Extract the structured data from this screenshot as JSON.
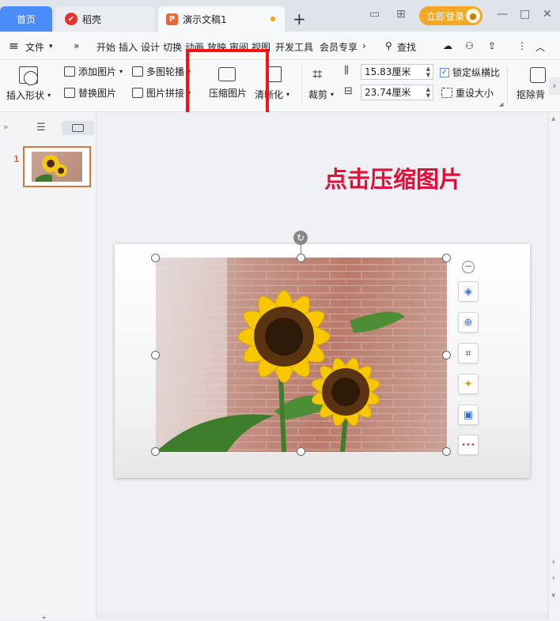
{
  "tabs": {
    "home": "首页",
    "daoke": "稻壳",
    "document": "演示文稿1",
    "new_tab": "+"
  },
  "header": {
    "login_label": "立即登录"
  },
  "menu": {
    "hamburger": "≡",
    "file": "文件",
    "more": "»",
    "items": [
      "开始",
      "插入",
      "设计",
      "切换",
      "动画",
      "放映",
      "审阅",
      "视图",
      "开发工具",
      "会员专享"
    ],
    "search": "查找"
  },
  "ribbon": {
    "insert_shape": "插入形状",
    "add_picture": "添加图片",
    "replace_picture": "替换图片",
    "multi_carousel": "多图轮播",
    "picture_stitch": "图片拼接",
    "compress_picture": "压缩图片",
    "clarify": "清晰化",
    "crop": "裁剪",
    "width_value": "15.83厘米",
    "height_value": "23.74厘米",
    "lock_ratio": "锁定纵横比",
    "reset_size": "重设大小",
    "remove_bg": "抠除背"
  },
  "slides": {
    "number": "1"
  },
  "canvas": {
    "instruction": "点击压缩图片"
  },
  "colors": {
    "accent": "#4a8df8",
    "highlight_red": "#ff1010",
    "instruction_red": "#e0103a",
    "login_orange": "#f5a623"
  }
}
